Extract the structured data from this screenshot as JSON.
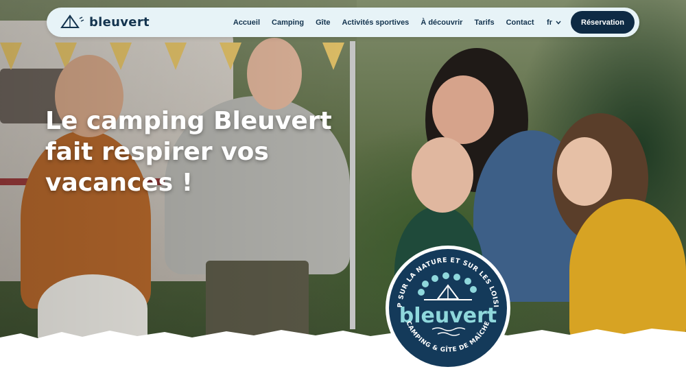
{
  "brand": {
    "name": "bleuvert",
    "logo_icon": "tent-icon"
  },
  "nav": {
    "items": [
      "Accueil",
      "Camping",
      "Gîte",
      "Activités sportives",
      "À découvrir",
      "Tarifs",
      "Contact"
    ],
    "language": "fr",
    "cta_label": "Réservation"
  },
  "hero": {
    "headline_lines": [
      "Le camping Bleuvert",
      "fait respirer vos",
      "vacances !"
    ]
  },
  "badge": {
    "top_text": "CAP SUR LA NATURE ET SUR LES LOISIRS",
    "name": "bleuvert",
    "bottom_text": "CAMPING & GÎTE DE MAÎCHE"
  },
  "colors": {
    "navy": "#0e2a44",
    "brand_text": "#14344f",
    "nav_bg": "#e7f3f7",
    "badge_bg": "#143a5a",
    "badge_accent": "#8fd8dc"
  }
}
